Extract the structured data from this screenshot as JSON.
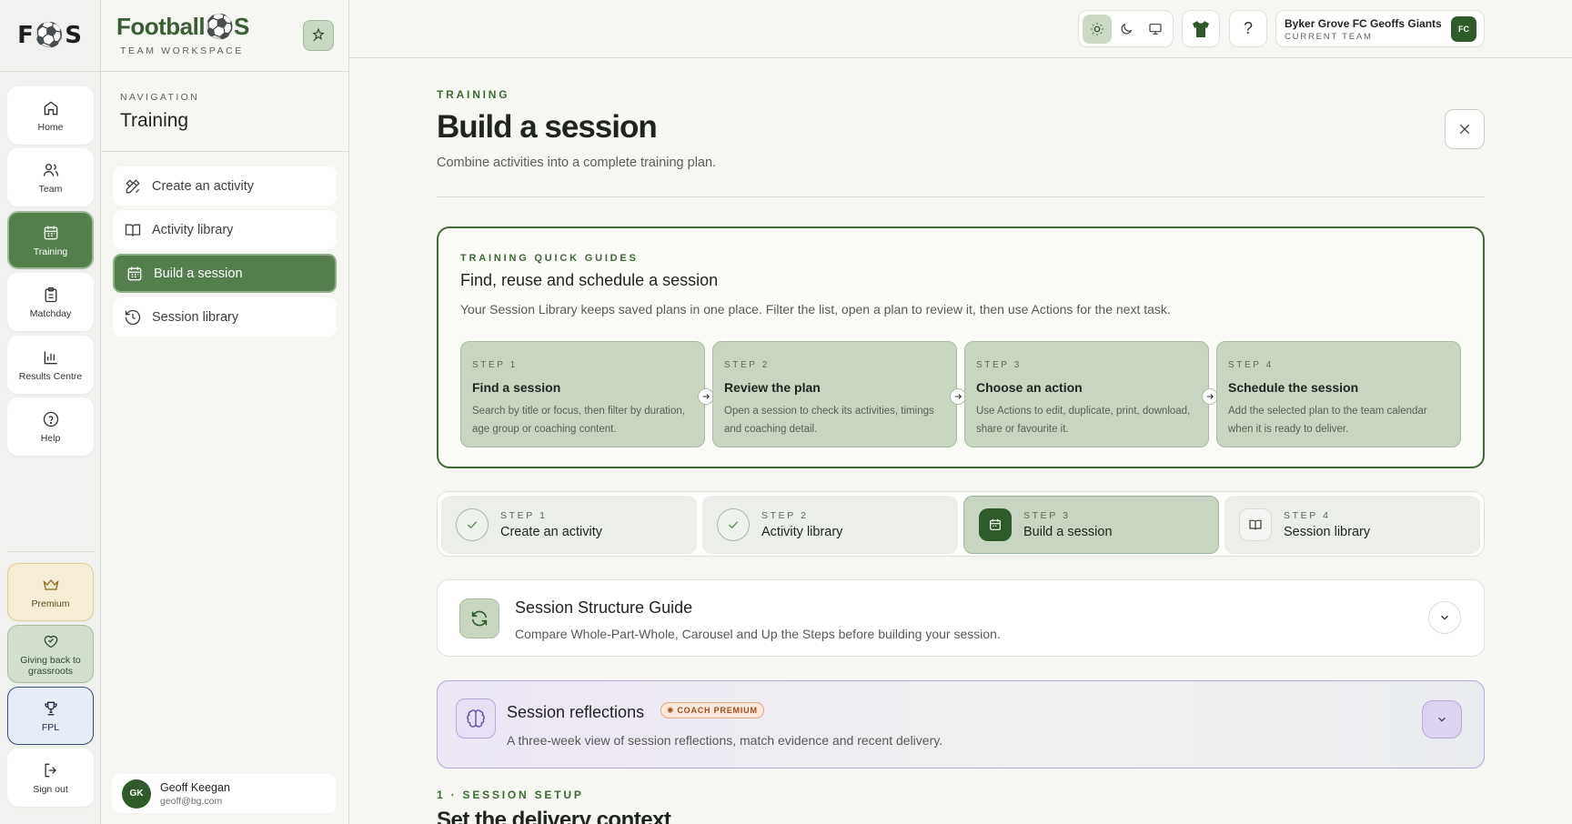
{
  "rail": {
    "logo": "F⚽S",
    "items": [
      {
        "label": "Home",
        "icon": "home-icon"
      },
      {
        "label": "Team",
        "icon": "users-icon"
      },
      {
        "label": "Training",
        "icon": "calendar-icon"
      },
      {
        "label": "Matchday",
        "icon": "clipboard-icon"
      },
      {
        "label": "Results Centre",
        "icon": "bar-chart-icon"
      },
      {
        "label": "Help",
        "icon": "help-circle-icon"
      }
    ],
    "bottom": [
      {
        "label": "Premium",
        "icon": "crown-icon"
      },
      {
        "label": "Giving back to grassroots",
        "icon": "heart-handshake-icon"
      },
      {
        "label": "FPL",
        "icon": "trophy-icon"
      },
      {
        "label": "Sign out",
        "icon": "log-out-icon"
      }
    ]
  },
  "brand": {
    "name": "Football⚽S",
    "sub": "TEAM WORKSPACE",
    "pin_icon": "sparkle-pin-icon"
  },
  "nav": {
    "kicker": "NAVIGATION",
    "title": "Training",
    "items": [
      {
        "label": "Create an activity",
        "icon": "pencil-ruler-icon"
      },
      {
        "label": "Activity library",
        "icon": "book-open-icon"
      },
      {
        "label": "Build a session",
        "icon": "calendar-icon"
      },
      {
        "label": "Session library",
        "icon": "history-icon"
      }
    ]
  },
  "user": {
    "initials": "GK",
    "name": "Geoff Keegan",
    "email": "geoff@bg.com"
  },
  "topbar": {
    "theme_icons": [
      "sun-icon",
      "moon-icon",
      "monitor-icon"
    ],
    "team": {
      "name": "Byker Grove FC Geoffs Giants",
      "sub": "CURRENT TEAM",
      "badge": "FC"
    },
    "help": "?"
  },
  "main": {
    "kicker": "TRAINING",
    "title": "Build a session",
    "desc": "Combine activities into a complete training plan.",
    "guide": {
      "kicker": "TRAINING QUICK GUIDES",
      "title": "Find, reuse and schedule a session",
      "desc": "Your Session Library keeps saved plans in one place. Filter the list, open a plan to review it, then use Actions for the next task.",
      "cards": [
        {
          "step": "STEP 1",
          "title": "Find a session",
          "desc": "Search by title or focus, then filter by duration, age group or coaching content."
        },
        {
          "step": "STEP 2",
          "title": "Review the plan",
          "desc": "Open a session to check its activities, timings and coaching detail."
        },
        {
          "step": "STEP 3",
          "title": "Choose an action",
          "desc": "Use Actions to edit, duplicate, print, download, share or favourite it."
        },
        {
          "step": "STEP 4",
          "title": "Schedule the session",
          "desc": "Add the selected plan to the team calendar when it is ready to deliver."
        }
      ]
    },
    "stepper": [
      {
        "step": "STEP 1",
        "label": "Create an activity",
        "state": "done"
      },
      {
        "step": "STEP 2",
        "label": "Activity library",
        "state": "done"
      },
      {
        "step": "STEP 3",
        "label": "Build a session",
        "state": "current"
      },
      {
        "step": "STEP 4",
        "label": "Session library",
        "state": "upcoming"
      }
    ],
    "structure": {
      "title": "Session Structure Guide",
      "desc": "Compare Whole-Part-Whole, Carousel and Up the Steps before building your session."
    },
    "reflections": {
      "title": "Session reflections",
      "badge": "COACH PREMIUM",
      "desc": "A three-week view of session reflections, match evidence and recent delivery."
    },
    "section": {
      "kicker": "1 · SESSION SETUP",
      "title": "Set the delivery context"
    }
  },
  "colors": {
    "accent": "#547f4c",
    "accent_dark": "#2f5a2a",
    "premium": "#f6edd6",
    "purple": "#b9a9d9"
  }
}
